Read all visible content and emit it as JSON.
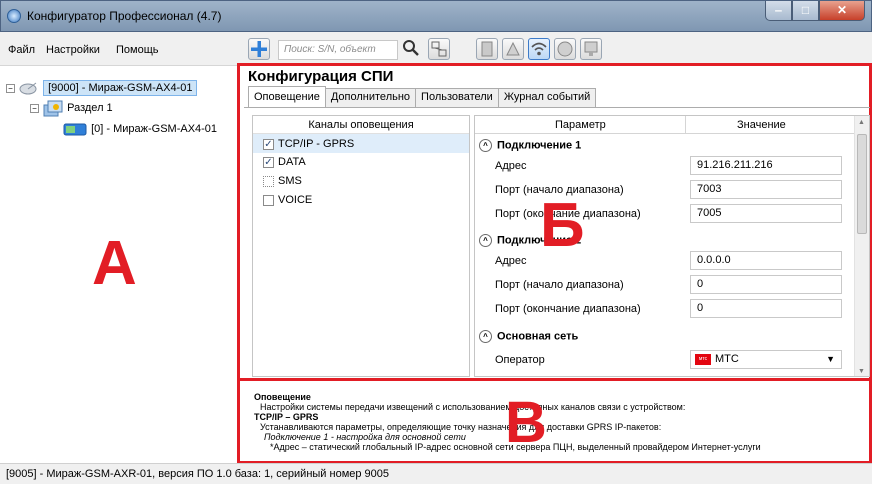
{
  "window": {
    "title": "Конфигуратор Профессионал (4.7)",
    "buttons": {
      "minimize": "‒",
      "maximize": "□",
      "close": "✕"
    }
  },
  "menu": {
    "file": "Файл",
    "settings": "Настройки",
    "help": "Помощь"
  },
  "toolbar": {
    "search_placeholder": "Поиск: S/N, объект"
  },
  "tree": {
    "root": "[9000] - Мираж-GSM-AX4-01",
    "partition": "Раздел 1",
    "device": "[0] - Мираж-GSM-AX4-01"
  },
  "annotations": {
    "a": "А",
    "b": "Б",
    "c": "В"
  },
  "config": {
    "title": "Конфигурация СПИ",
    "tabs": [
      "Оповещение",
      "Дополнительно",
      "Пользователи",
      "Журнал событий"
    ],
    "channels_header": "Каналы оповещения",
    "channels": [
      {
        "label": "TCP/IP - GPRS",
        "checked": true
      },
      {
        "label": "DATA",
        "checked": true
      },
      {
        "label": "SMS",
        "checked": false
      },
      {
        "label": "VOICE",
        "checked": false
      }
    ],
    "param_header": "Параметр",
    "value_header": "Значение",
    "sections": [
      {
        "title": "Подключение 1",
        "rows": [
          {
            "label": "Адрес",
            "value": "91.216.211.216"
          },
          {
            "label": "Порт (начало диапазона)",
            "value": "7003"
          },
          {
            "label": "Порт (окончание диапазона)",
            "value": "7005"
          }
        ]
      },
      {
        "title": "Подключение 2",
        "rows": [
          {
            "label": "Адрес",
            "value": "0.0.0.0"
          },
          {
            "label": "Порт (начало диапазона)",
            "value": "0"
          },
          {
            "label": "Порт (окончание диапазона)",
            "value": "0"
          }
        ]
      },
      {
        "title": "Основная сеть",
        "rows": [
          {
            "label": "Оператор",
            "value": "МТС",
            "logo": "мтс"
          }
        ]
      }
    ]
  },
  "description": {
    "heading": "Оповещение",
    "line1": "Настройки системы передачи извещений с использованием доступных каналов связи с устройством:",
    "subheading": "TCP/IP – GPRS",
    "line2": "Устанавливаются параметры, определяющие точку назначения для доставки GPRS IP-пакетов:",
    "line3": "Подключение 1 - настройка для основной сети",
    "line4": "*Адрес – статический глобальный IP-адрес основной сети сервера ПЦН, выделенный провайдером Интернет-услуги"
  },
  "status": "[9005] - Мираж-GSM-AXR-01, версия ПО 1.0 база: 1, серийный номер 9005",
  "colors": {
    "annotation_red": "#e21d25",
    "selection": "#cde4f7"
  }
}
